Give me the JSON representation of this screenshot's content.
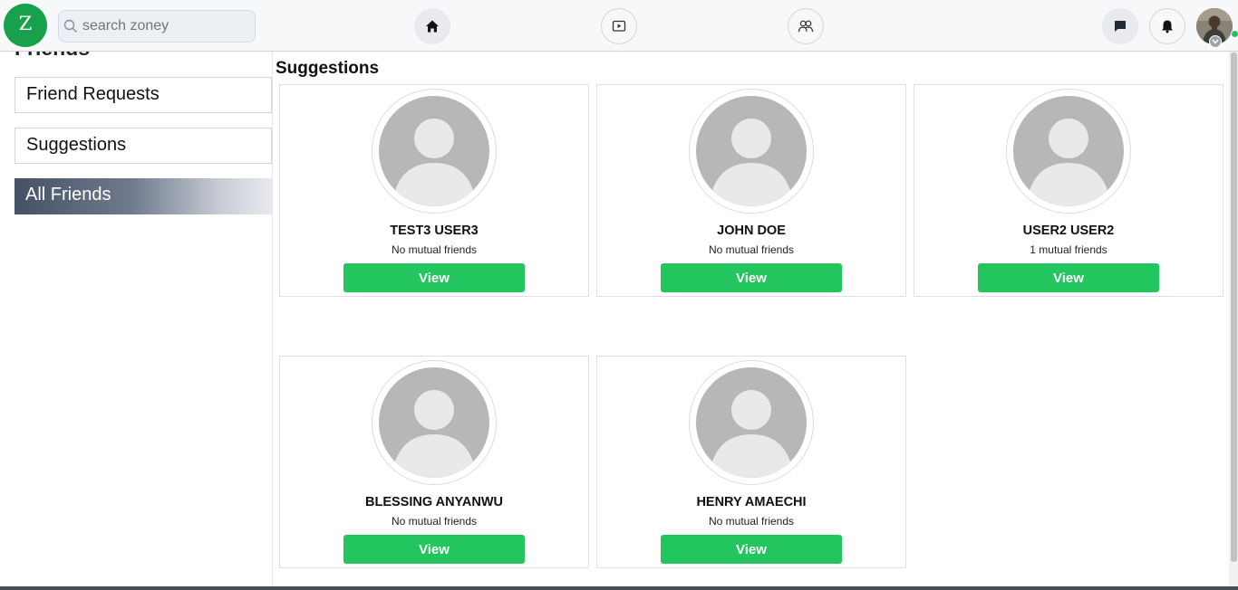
{
  "header": {
    "logo_letter": "Z",
    "search_placeholder": "search zoney",
    "nav": [
      {
        "name": "home",
        "icon": "home-icon"
      },
      {
        "name": "watch",
        "icon": "video-icon"
      },
      {
        "name": "friends",
        "icon": "friends-icon"
      }
    ],
    "actions": [
      {
        "name": "messages",
        "icon": "chat-icon"
      },
      {
        "name": "notifications",
        "icon": "bell-icon"
      }
    ],
    "accent_color": "#17a14a",
    "online_color": "#22c55e"
  },
  "sidebar": {
    "title": "Friends",
    "items": [
      {
        "label": "Friend Requests",
        "active": false
      },
      {
        "label": "Suggestions",
        "active": false
      },
      {
        "label": "All Friends",
        "active": true
      }
    ]
  },
  "main": {
    "title": "Suggestions",
    "button_color": "#22c55e",
    "cards": [
      {
        "name": "TEST3 USER3",
        "mutual": "No mutual friends",
        "button": "View"
      },
      {
        "name": "JOHN DOE",
        "mutual": "No mutual friends",
        "button": "View"
      },
      {
        "name": "USER2 USER2",
        "mutual": "1 mutual friends",
        "button": "View"
      },
      {
        "name": "BLESSING ANYANWU",
        "mutual": "No mutual friends",
        "button": "View"
      },
      {
        "name": "HENRY AMAECHI",
        "mutual": "No mutual friends",
        "button": "View"
      }
    ]
  }
}
